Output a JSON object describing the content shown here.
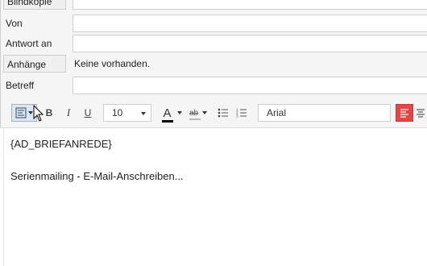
{
  "fields": {
    "bcc_label": "Blindkopie",
    "from_label": "Von",
    "reply_to_label": "Antwort an",
    "attachments_label": "Anhänge",
    "attachments_value": "Keine vorhanden.",
    "subject_label": "Betreff"
  },
  "toolbar": {
    "bold": "B",
    "italic": "I",
    "underline": "U",
    "font_size": "10",
    "font_family": "Arial",
    "font_color_label": "A",
    "highlight_label": "ab",
    "accent_color": "#e04848"
  },
  "editor": {
    "line1": "{AD_BRIEFANREDE}",
    "line2": "Serienmailing - E-Mail-Anschreiben..."
  },
  "icons": [
    "format-block-icon",
    "bullet-list-icon",
    "numbered-list-icon",
    "align-left-icon",
    "align-center-icon",
    "cursor-icon"
  ]
}
